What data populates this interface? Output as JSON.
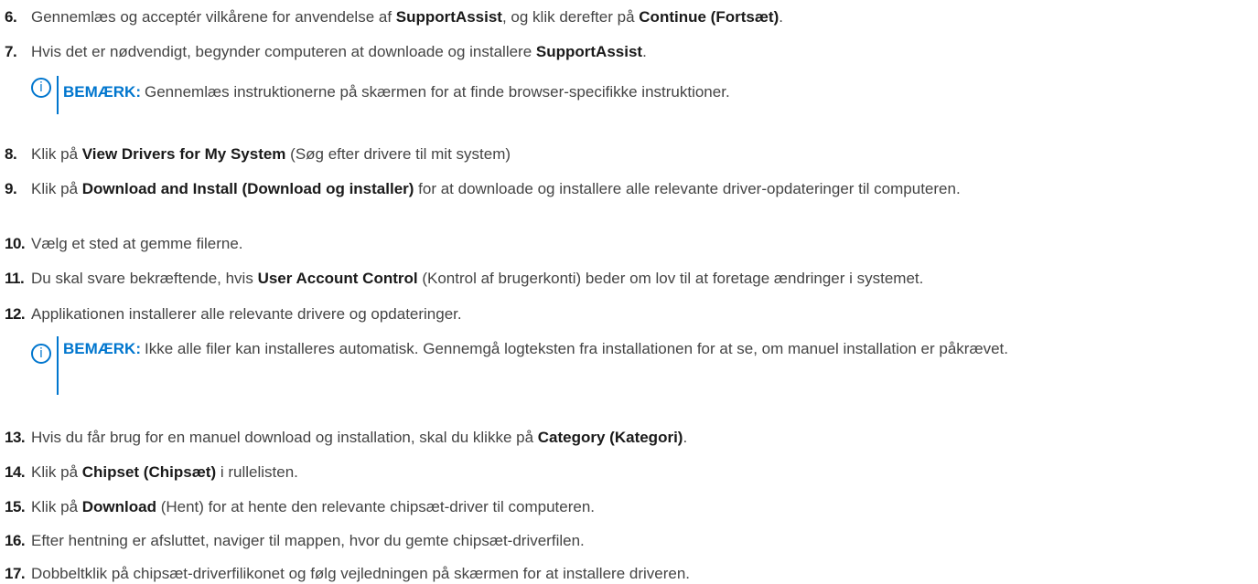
{
  "steps": [
    {
      "number": "6.",
      "parts": [
        {
          "t": "Gennemlæs og acceptér vilkårene for anvendelse af ",
          "b": false
        },
        {
          "t": "SupportAssist",
          "b": true
        },
        {
          "t": ", og klik derefter på ",
          "b": false
        },
        {
          "t": "Continue (Fortsæt)",
          "b": true
        },
        {
          "t": ".",
          "b": false
        }
      ]
    },
    {
      "number": "7.",
      "parts": [
        {
          "t": "Hvis det er nødvendigt, begynder computeren at downloade og installere ",
          "b": false
        },
        {
          "t": "SupportAssist",
          "b": true
        },
        {
          "t": ".",
          "b": false
        }
      ]
    },
    {
      "number": "8.",
      "parts": [
        {
          "t": "Klik på ",
          "b": false
        },
        {
          "t": "View Drivers for My System",
          "b": true
        },
        {
          "t": " (Søg efter drivere til mit system)",
          "b": false
        }
      ]
    },
    {
      "number": "9.",
      "parts": [
        {
          "t": "Klik på ",
          "b": false
        },
        {
          "t": "Download and Install (Download og installer)",
          "b": true
        },
        {
          "t": " for at downloade og installere alle relevante driver-opdateringer til computeren.",
          "b": false
        }
      ]
    },
    {
      "number": "10.",
      "parts": [
        {
          "t": "Vælg et sted at gemme filerne.",
          "b": false
        }
      ]
    },
    {
      "number": "11.",
      "parts": [
        {
          "t": "Du skal svare bekræftende, hvis ",
          "b": false
        },
        {
          "t": "User Account Control",
          "b": true
        },
        {
          "t": " (Kontrol af brugerkonti) beder om lov til at foretage ændringer i systemet.",
          "b": false
        }
      ]
    },
    {
      "number": "12.",
      "parts": [
        {
          "t": "Applikationen installerer alle relevante drivere og opdateringer.",
          "b": false
        }
      ]
    },
    {
      "number": "13.",
      "parts": [
        {
          "t": "Hvis du får brug for en manuel download og installation, skal du klikke på ",
          "b": false
        },
        {
          "t": "Category (Kategori)",
          "b": true
        },
        {
          "t": ".",
          "b": false
        }
      ]
    },
    {
      "number": "14.",
      "parts": [
        {
          "t": "Klik på ",
          "b": false
        },
        {
          "t": "Chipset (Chipsæt)",
          "b": true
        },
        {
          "t": " i rullelisten.",
          "b": false
        }
      ]
    },
    {
      "number": "15.",
      "parts": [
        {
          "t": "Klik på ",
          "b": false
        },
        {
          "t": "Download",
          "b": true
        },
        {
          "t": " (Hent) for at hente den relevante chipsæt-driver til computeren.",
          "b": false
        }
      ]
    },
    {
      "number": "16.",
      "parts": [
        {
          "t": "Efter hentning er afsluttet, naviger til mappen, hvor du gemte chipsæt-driverfilen.",
          "b": false
        }
      ]
    },
    {
      "number": "17.",
      "parts": [
        {
          "t": "Dobbeltklik på chipsæt-driverfilikonet og følg vejledningen på skærmen for at installere driveren.",
          "b": false
        }
      ]
    }
  ],
  "notes": [
    {
      "label": "BEMÆRK:",
      "text": "Gennemlæs instruktionerne på skærmen for at finde browser-specifikke instruktioner.",
      "icon": "info-icon"
    },
    {
      "label": "BEMÆRK:",
      "text": "Ikke alle filer kan installeres automatisk. Gennemgå logteksten fra installationen for at se, om manuel installation er påkrævet.",
      "icon": "info-icon"
    }
  ],
  "colors": {
    "accent": "#0076ce",
    "text": "#444444",
    "strong": "#1a1a1a"
  }
}
